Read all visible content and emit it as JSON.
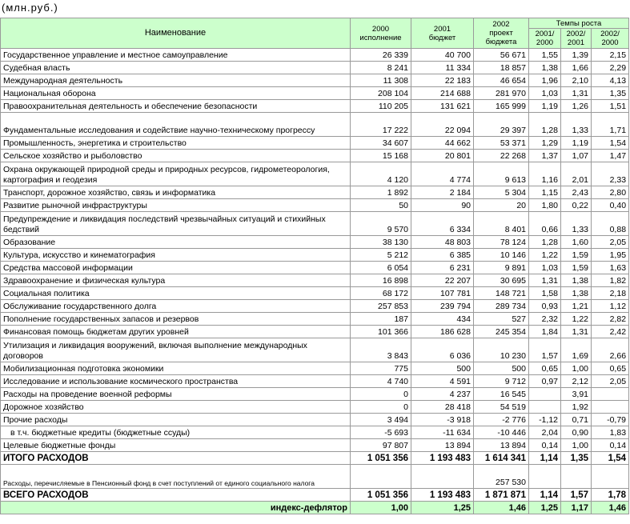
{
  "caption": "(млн.руб.)",
  "header": {
    "name": "Наименование",
    "c2000": [
      "2000",
      "исполнение"
    ],
    "c2001": [
      "2001",
      "бюджет"
    ],
    "c2002": [
      "2002",
      "проект",
      "бюджета"
    ],
    "rates": "Темпы роста",
    "r1": [
      "2001/",
      "2000"
    ],
    "r2": [
      "2002/",
      "2001"
    ],
    "r3": [
      "2002/",
      "2000"
    ]
  },
  "rows": [
    {
      "name": "Государственное управление и местное самоуправление",
      "v": [
        "26 339",
        "40 700",
        "56 671",
        "1,55",
        "1,39",
        "2,15"
      ]
    },
    {
      "name": "Судебная власть",
      "v": [
        "8 241",
        "11 334",
        "18 857",
        "1,38",
        "1,66",
        "2,29"
      ]
    },
    {
      "name": "Международная деятельность",
      "v": [
        "11 308",
        "22 183",
        "46 654",
        "1,96",
        "2,10",
        "4,13"
      ]
    },
    {
      "name": "Национальная оборона",
      "v": [
        "208 104",
        "214 688",
        "281 970",
        "1,03",
        "1,31",
        "1,35"
      ]
    },
    {
      "name": "Правоохранительная деятельность и обеспечение безопасности",
      "v": [
        "110 205",
        "131 621",
        "165 999",
        "1,19",
        "1,26",
        "1,51"
      ]
    },
    {
      "name": "Фундаментальные исследования и содействие научно-техническому прогрессу",
      "v": [
        "17 222",
        "22 094",
        "29 397",
        "1,28",
        "1,33",
        "1,71"
      ],
      "tall": true
    },
    {
      "name": "Промышленность, энергетика и строительство",
      "v": [
        "34 607",
        "44 662",
        "53 371",
        "1,29",
        "1,19",
        "1,54"
      ]
    },
    {
      "name": "Сельское хозяйство и рыболовство",
      "v": [
        "15 168",
        "20 801",
        "22 268",
        "1,37",
        "1,07",
        "1,47"
      ]
    },
    {
      "name": "Охрана окружающей природной среды и природных ресурсов, гидрометеорология, картография и геодезия",
      "v": [
        "4 120",
        "4 774",
        "9 613",
        "1,16",
        "2,01",
        "2,33"
      ],
      "tall": true
    },
    {
      "name": "Транспорт, дорожное хозяйство, связь и информатика",
      "v": [
        "1 892",
        "2 184",
        "5 304",
        "1,15",
        "2,43",
        "2,80"
      ]
    },
    {
      "name": "Развитие рыночной инфраструктуры",
      "v": [
        "50",
        "90",
        "20",
        "1,80",
        "0,22",
        "0,40"
      ]
    },
    {
      "name": "Предупреждение и ликвидация последствий чрезвычайных ситуаций и стихийных бедствий",
      "v": [
        "9 570",
        "6 334",
        "8 401",
        "0,66",
        "1,33",
        "0,88"
      ],
      "tall": true
    },
    {
      "name": "Образование",
      "v": [
        "38 130",
        "48 803",
        "78 124",
        "1,28",
        "1,60",
        "2,05"
      ]
    },
    {
      "name": "Культура, искусство и кинематография",
      "v": [
        "5 212",
        "6 385",
        "10 146",
        "1,22",
        "1,59",
        "1,95"
      ]
    },
    {
      "name": "Средства массовой информации",
      "v": [
        "6 054",
        "6 231",
        "9 891",
        "1,03",
        "1,59",
        "1,63"
      ]
    },
    {
      "name": "Здравоохранение и физическая культура",
      "v": [
        "16 898",
        "22 207",
        "30 695",
        "1,31",
        "1,38",
        "1,82"
      ]
    },
    {
      "name": "Социальная политика",
      "v": [
        "68 172",
        "107 781",
        "148 721",
        "1,58",
        "1,38",
        "2,18"
      ]
    },
    {
      "name": "Обслуживание государственного долга",
      "v": [
        "257 853",
        "239 794",
        "289 734",
        "0,93",
        "1,21",
        "1,12"
      ]
    },
    {
      "name": "Пополнение государственных запасов и резервов",
      "v": [
        "187",
        "434",
        "527",
        "2,32",
        "1,22",
        "2,82"
      ]
    },
    {
      "name": "Финансовая помощь бюджетам других уровней",
      "v": [
        "101 366",
        "186 628",
        "245 354",
        "1,84",
        "1,31",
        "2,42"
      ]
    },
    {
      "name": "Утилизация и ликвидация вооружений, включая выполнение международных договоров",
      "v": [
        "3 843",
        "6 036",
        "10 230",
        "1,57",
        "1,69",
        "2,66"
      ],
      "tall": true
    },
    {
      "name": "Мобилизационная подготовка экономики",
      "v": [
        "775",
        "500",
        "500",
        "0,65",
        "1,00",
        "0,65"
      ]
    },
    {
      "name": "Исследование и использование космического пространства",
      "v": [
        "4 740",
        "4 591",
        "9 712",
        "0,97",
        "2,12",
        "2,05"
      ]
    },
    {
      "name": "Расходы на проведение военной реформы",
      "v": [
        "0",
        "4 237",
        "16 545",
        "",
        "3,91",
        ""
      ]
    },
    {
      "name": "Дорожное хозяйство",
      "v": [
        "0",
        "28 418",
        "54 519",
        "",
        "1,92",
        ""
      ]
    },
    {
      "name": "Прочие расходы",
      "v": [
        "3 494",
        "-3 918",
        "-2 776",
        "-1,12",
        "0,71",
        "-0,79"
      ]
    },
    {
      "name": "в т.ч. бюджетные кредиты (бюджетные ссуды)",
      "v": [
        "-5 693",
        "-11 634",
        "-10 446",
        "2,04",
        "0,90",
        "1,83"
      ],
      "indent": true
    },
    {
      "name": "Целевые бюджетные фонды",
      "v": [
        "97 807",
        "13 894",
        "13 894",
        "0,14",
        "1,00",
        "0,14"
      ]
    },
    {
      "name": "ИТОГО РАСХОДОВ",
      "v": [
        "1 051 356",
        "1 193 483",
        "1 614 341",
        "1,14",
        "1,35",
        "1,54"
      ],
      "bold": true
    },
    {
      "name": "Расходы, перечисляемые в Пенсионный фонд в счет поступлений от единого социального налога",
      "v": [
        "",
        "",
        "257 530",
        "",
        "",
        ""
      ],
      "tall": true,
      "note": true
    },
    {
      "name": "ВСЕГО РАСХОДОВ",
      "v": [
        "1 051 356",
        "1 193 483",
        "1 871 871",
        "1,14",
        "1,57",
        "1,78"
      ],
      "bold": true
    }
  ],
  "deflator": {
    "label": "индекс-дефлятор",
    "v": [
      "1,00",
      "1,25",
      "1,46",
      "1,25",
      "1,17",
      "1,46"
    ]
  }
}
